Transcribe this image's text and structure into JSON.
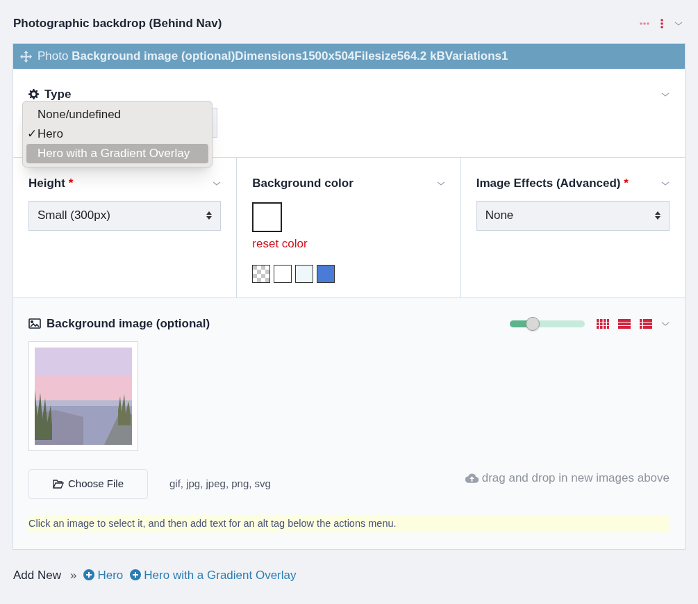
{
  "title": "Photographic backdrop (Behind Nav)",
  "bar": {
    "text": "Photo **Background image (optional)Dimensions1500x504Filesize564.2 kBVariations1**"
  },
  "required_mark": "*",
  "check_glyph": "✓",
  "type_field": {
    "label": "Type",
    "menu": [
      {
        "label": "None/undefined",
        "checked": false,
        "selected": false
      },
      {
        "label": "Hero",
        "checked": true,
        "selected": false
      },
      {
        "label": "Hero with a Gradient Overlay",
        "checked": false,
        "selected": true
      }
    ]
  },
  "height": {
    "label": "Height",
    "required": true,
    "value": "Small (300px)"
  },
  "background_color": {
    "label": "Background color",
    "reset": "reset color",
    "swatches": [
      {
        "kind": "transparent"
      },
      {
        "kind": "solid",
        "color": "#ffffff"
      },
      {
        "kind": "solid",
        "color": "#eef7fa"
      },
      {
        "kind": "solid",
        "color": "#4a7bd6"
      }
    ]
  },
  "image_effects": {
    "label": "Image Effects (Advanced)",
    "required": true,
    "value": "None"
  },
  "background_image": {
    "label": "Background image (optional)",
    "zoom": {
      "level": 0.31
    },
    "choose_file": "Choose File",
    "types": "gif, jpg, jpeg, png, svg",
    "drop_hint": "drag and drop in new images above",
    "help": "Click an image to select it, and then add text for an alt tag below the actions menu."
  },
  "add_new": {
    "label": "Add New",
    "separator": "»",
    "links": [
      "Hero",
      "Hero with a Gradient Overlay"
    ]
  }
}
